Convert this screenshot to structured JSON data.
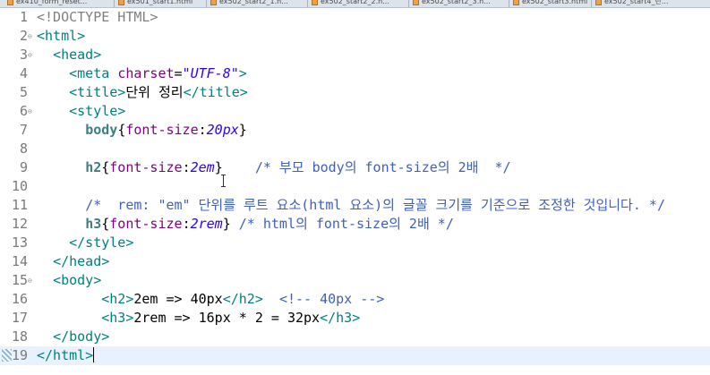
{
  "tabs": [
    "ex410_form_reset...",
    "ex501_start1.html",
    "ex502_start2_1.h...",
    "ex502_start2_2.h...",
    "ex502_start2_3.h...",
    "ex502_start3.html",
    "ex502_start4_단..."
  ],
  "lines": [
    {
      "n": "1",
      "fold": "",
      "tokens": [
        {
          "t": "<!DOCTYPE HTML>",
          "c": "m-doc"
        }
      ]
    },
    {
      "n": "2",
      "fold": "⊖",
      "tokens": [
        {
          "t": "<html>",
          "c": "m-tag"
        }
      ]
    },
    {
      "n": "3",
      "fold": "⊖",
      "tokens": [
        {
          "t": "  ",
          "c": "m-txt"
        },
        {
          "t": "<head>",
          "c": "m-tag"
        }
      ]
    },
    {
      "n": "4",
      "fold": "",
      "tokens": [
        {
          "t": "    ",
          "c": "m-txt"
        },
        {
          "t": "<meta ",
          "c": "m-tag"
        },
        {
          "t": "charset",
          "c": "m-attr"
        },
        {
          "t": "=",
          "c": "m-txt"
        },
        {
          "t": "\"UTF-8\"",
          "c": "m-val"
        },
        {
          "t": ">",
          "c": "m-tag"
        }
      ]
    },
    {
      "n": "5",
      "fold": "",
      "tokens": [
        {
          "t": "    ",
          "c": "m-txt"
        },
        {
          "t": "<title>",
          "c": "m-tag"
        },
        {
          "t": "단위 정리",
          "c": "m-txt"
        },
        {
          "t": "</title>",
          "c": "m-tag"
        }
      ]
    },
    {
      "n": "6",
      "fold": "⊖",
      "tokens": [
        {
          "t": "    ",
          "c": "m-txt"
        },
        {
          "t": "<style>",
          "c": "m-tag"
        }
      ]
    },
    {
      "n": "7",
      "fold": "",
      "tokens": [
        {
          "t": "      ",
          "c": "m-txt"
        },
        {
          "t": "body",
          "c": "m-sel"
        },
        {
          "t": "{",
          "c": "m-txt"
        },
        {
          "t": "font-size",
          "c": "m-prop"
        },
        {
          "t": ":",
          "c": "m-txt"
        },
        {
          "t": "20px",
          "c": "m-num"
        },
        {
          "t": "}",
          "c": "m-txt"
        }
      ]
    },
    {
      "n": "8",
      "fold": "",
      "tokens": []
    },
    {
      "n": "9",
      "fold": "",
      "tokens": [
        {
          "t": "      ",
          "c": "m-txt"
        },
        {
          "t": "h2",
          "c": "m-sel"
        },
        {
          "t": "{",
          "c": "m-txt"
        },
        {
          "t": "font-size",
          "c": "m-prop"
        },
        {
          "t": ":",
          "c": "m-txt"
        },
        {
          "t": "2em",
          "c": "m-num"
        },
        {
          "t": "}    ",
          "c": "m-txt"
        },
        {
          "t": "/* 부모 body의 font-size의 2배  */",
          "c": "m-cmt"
        }
      ]
    },
    {
      "n": "10",
      "fold": "",
      "tokens": []
    },
    {
      "n": "11",
      "fold": "",
      "tokens": [
        {
          "t": "      ",
          "c": "m-txt"
        },
        {
          "t": "/*  rem: \"em\" 단위를 루트 요소(html 요소)의 글꼴 크기를 기준으로 조정한 것입니다. */",
          "c": "m-cmt"
        }
      ]
    },
    {
      "n": "12",
      "fold": "",
      "tokens": [
        {
          "t": "      ",
          "c": "m-txt"
        },
        {
          "t": "h3",
          "c": "m-sel"
        },
        {
          "t": "{",
          "c": "m-txt"
        },
        {
          "t": "font-size",
          "c": "m-prop"
        },
        {
          "t": ":",
          "c": "m-txt"
        },
        {
          "t": "2rem",
          "c": "m-num"
        },
        {
          "t": "} ",
          "c": "m-txt"
        },
        {
          "t": "/* html의 font-size의 2배 */",
          "c": "m-cmt"
        }
      ]
    },
    {
      "n": "13",
      "fold": "",
      "tokens": [
        {
          "t": "    ",
          "c": "m-txt"
        },
        {
          "t": "</style>",
          "c": "m-tag"
        }
      ]
    },
    {
      "n": "14",
      "fold": "",
      "tokens": [
        {
          "t": "  ",
          "c": "m-txt"
        },
        {
          "t": "</head>",
          "c": "m-tag"
        }
      ]
    },
    {
      "n": "15",
      "fold": "⊖",
      "tokens": [
        {
          "t": "  ",
          "c": "m-txt"
        },
        {
          "t": "<body>",
          "c": "m-tag"
        }
      ]
    },
    {
      "n": "16",
      "fold": "",
      "tokens": [
        {
          "t": "        ",
          "c": "m-txt"
        },
        {
          "t": "<h2>",
          "c": "m-tag"
        },
        {
          "t": "2em => 40px",
          "c": "m-txt"
        },
        {
          "t": "</h2>",
          "c": "m-tag"
        },
        {
          "t": "  ",
          "c": "m-txt"
        },
        {
          "t": "<!-- 40px -->",
          "c": "m-hcmt"
        }
      ]
    },
    {
      "n": "17",
      "fold": "",
      "tokens": [
        {
          "t": "        ",
          "c": "m-txt"
        },
        {
          "t": "<h3>",
          "c": "m-tag"
        },
        {
          "t": "2rem => 16px * 2 = 32px",
          "c": "m-txt"
        },
        {
          "t": "</h3>",
          "c": "m-tag"
        }
      ]
    },
    {
      "n": "18",
      "fold": "",
      "tokens": [
        {
          "t": "  ",
          "c": "m-txt"
        },
        {
          "t": "</body>",
          "c": "m-tag"
        }
      ]
    },
    {
      "n": "19",
      "fold": "",
      "tokens": [
        {
          "t": "</html>",
          "c": "m-tag"
        }
      ]
    }
  ]
}
